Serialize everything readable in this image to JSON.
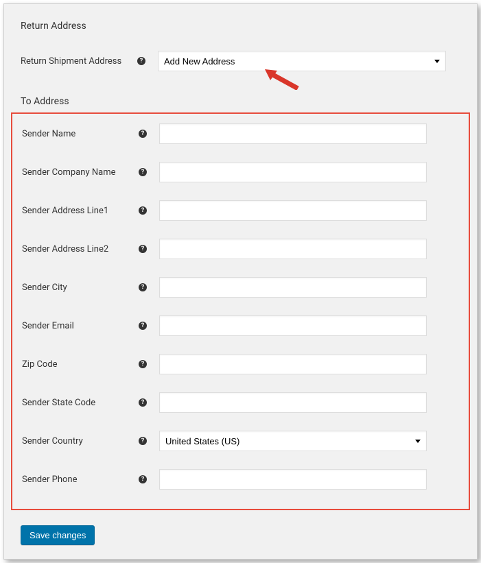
{
  "sections": {
    "return_address_title": "Return Address",
    "to_address_title": "To Address"
  },
  "return": {
    "label": "Return Shipment Address",
    "selected": "Add New Address"
  },
  "fields": {
    "sender_name": {
      "label": "Sender Name",
      "value": ""
    },
    "sender_company": {
      "label": "Sender Company Name",
      "value": ""
    },
    "sender_addr1": {
      "label": "Sender Address Line1",
      "value": ""
    },
    "sender_addr2": {
      "label": "Sender Address Line2",
      "value": ""
    },
    "sender_city": {
      "label": "Sender City",
      "value": ""
    },
    "sender_email": {
      "label": "Sender Email",
      "value": ""
    },
    "zip": {
      "label": "Zip Code",
      "value": ""
    },
    "state": {
      "label": "Sender State Code",
      "value": ""
    },
    "country": {
      "label": "Sender Country",
      "selected": "United States (US)"
    },
    "phone": {
      "label": "Sender Phone",
      "value": ""
    }
  },
  "buttons": {
    "save": "Save changes"
  },
  "help_glyph": "?"
}
